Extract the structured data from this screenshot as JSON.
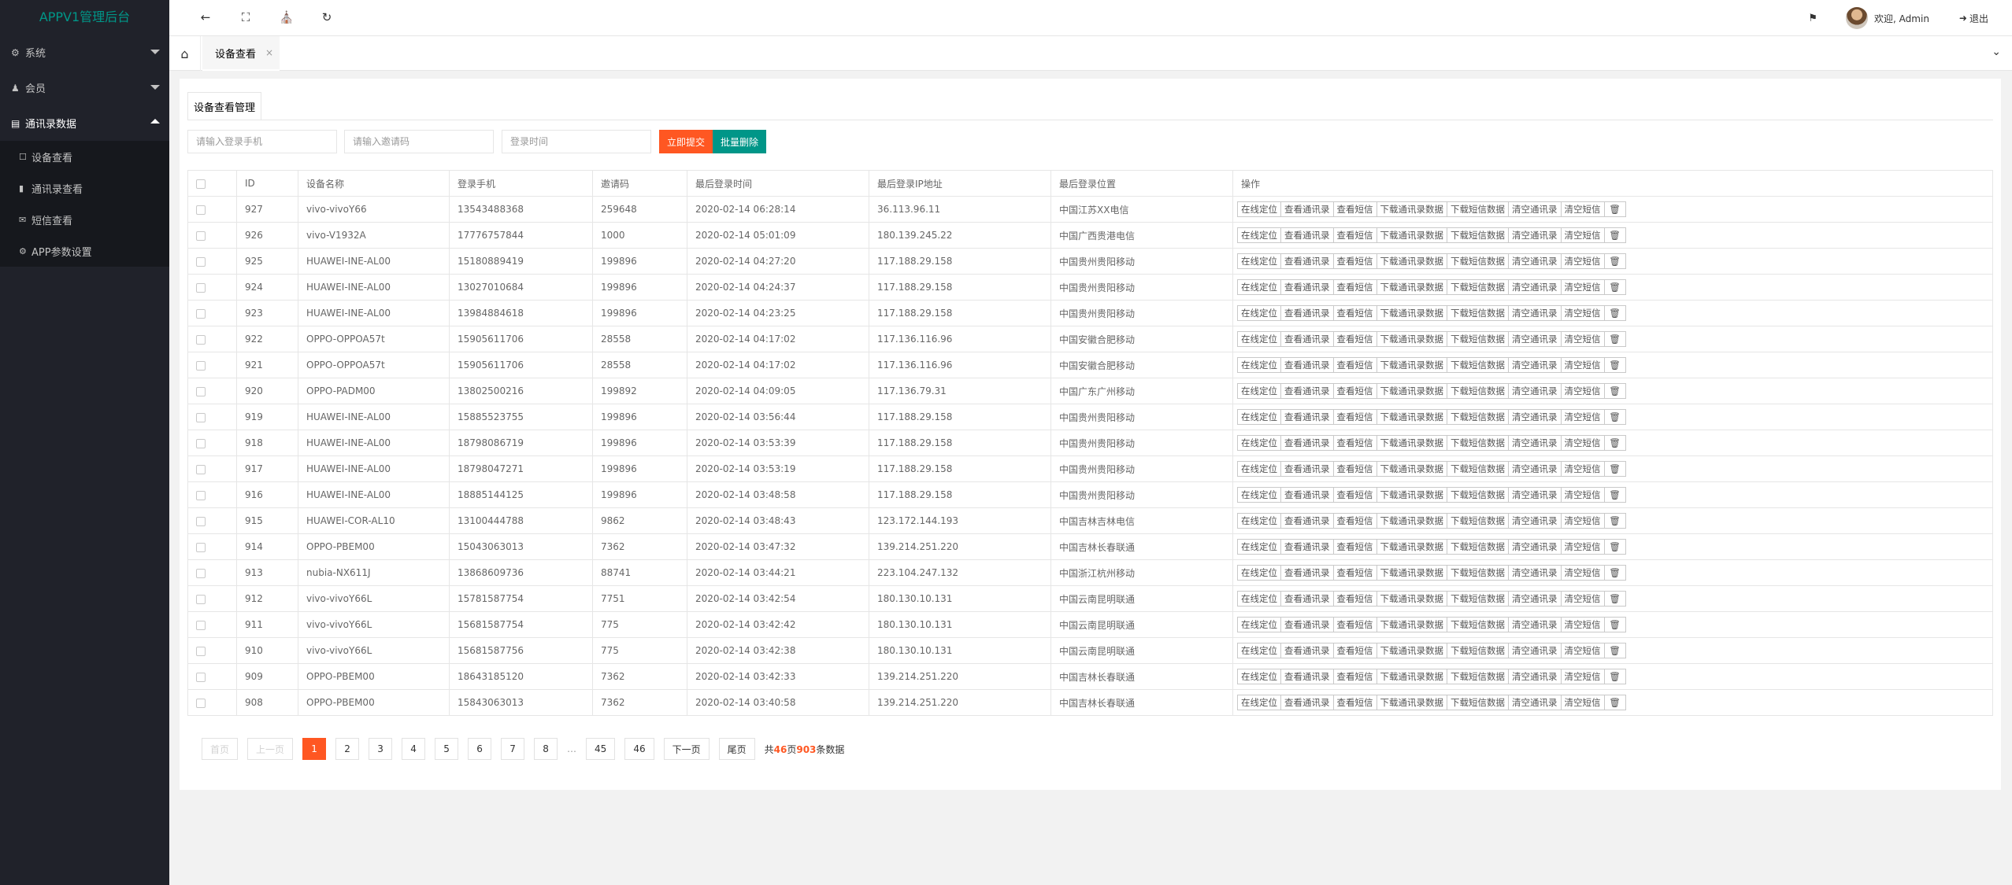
{
  "app": {
    "title": "APPV1管理后台"
  },
  "sidebar": {
    "menus": [
      {
        "label": "系统",
        "icon": "gear-icon",
        "glyph": "⚙"
      },
      {
        "label": "会员",
        "icon": "users-icon",
        "glyph": "👥"
      },
      {
        "label": "通讯录数据",
        "icon": "table-icon",
        "glyph": "▤"
      }
    ],
    "sub": [
      {
        "label": "设备查看",
        "icon": "lock-icon",
        "glyph": "🔒"
      },
      {
        "label": "通讯录查看",
        "icon": "book-icon",
        "glyph": "📕"
      },
      {
        "label": "短信查看",
        "icon": "envelope-icon",
        "glyph": "✉"
      },
      {
        "label": "APP参数设置",
        "icon": "gear-icon",
        "glyph": "⚙"
      }
    ]
  },
  "header": {
    "welcome": "欢迎, Admin",
    "logout": "退出"
  },
  "tabs": {
    "current": "设备查看",
    "close": "×"
  },
  "panel": {
    "title": "设备查看管理"
  },
  "search": {
    "phone_placeholder": "请输入登录手机",
    "invite_placeholder": "请输入邀请码",
    "time_placeholder": "登录时间",
    "submit": "立即提交",
    "batch_delete": "批量删除"
  },
  "table": {
    "headers": [
      "ID",
      "设备名称",
      "登录手机",
      "邀请码",
      "最后登录时间",
      "最后登录IP地址",
      "最后登录位置",
      "操作"
    ],
    "actions": [
      "在线定位",
      "查看通讯录",
      "查看短信",
      "下载通讯录数据",
      "下载短信数据",
      "清空通讯录",
      "清空短信"
    ],
    "rows": [
      [
        "927",
        "vivo-vivoY66",
        "13543488368",
        "259648",
        "2020-02-14 06:28:14",
        "36.113.96.11",
        "中国江苏XX电信"
      ],
      [
        "926",
        "vivo-V1932A",
        "17776757844",
        "1000",
        "2020-02-14 05:01:09",
        "180.139.245.22",
        "中国广西贵港电信"
      ],
      [
        "925",
        "HUAWEI-INE-AL00",
        "15180889419",
        "199896",
        "2020-02-14 04:27:20",
        "117.188.29.158",
        "中国贵州贵阳移动"
      ],
      [
        "924",
        "HUAWEI-INE-AL00",
        "13027010684",
        "199896",
        "2020-02-14 04:24:37",
        "117.188.29.158",
        "中国贵州贵阳移动"
      ],
      [
        "923",
        "HUAWEI-INE-AL00",
        "13984884618",
        "199896",
        "2020-02-14 04:23:25",
        "117.188.29.158",
        "中国贵州贵阳移动"
      ],
      [
        "922",
        "OPPO-OPPOA57t",
        "15905611706",
        "28558",
        "2020-02-14 04:17:02",
        "117.136.116.96",
        "中国安徽合肥移动"
      ],
      [
        "921",
        "OPPO-OPPOA57t",
        "15905611706",
        "28558",
        "2020-02-14 04:17:02",
        "117.136.116.96",
        "中国安徽合肥移动"
      ],
      [
        "920",
        "OPPO-PADM00",
        "13802500216",
        "199892",
        "2020-02-14 04:09:05",
        "117.136.79.31",
        "中国广东广州移动"
      ],
      [
        "919",
        "HUAWEI-INE-AL00",
        "15885523755",
        "199896",
        "2020-02-14 03:56:44",
        "117.188.29.158",
        "中国贵州贵阳移动"
      ],
      [
        "918",
        "HUAWEI-INE-AL00",
        "18798086719",
        "199896",
        "2020-02-14 03:53:39",
        "117.188.29.158",
        "中国贵州贵阳移动"
      ],
      [
        "917",
        "HUAWEI-INE-AL00",
        "18798047271",
        "199896",
        "2020-02-14 03:53:19",
        "117.188.29.158",
        "中国贵州贵阳移动"
      ],
      [
        "916",
        "HUAWEI-INE-AL00",
        "18885144125",
        "199896",
        "2020-02-14 03:48:58",
        "117.188.29.158",
        "中国贵州贵阳移动"
      ],
      [
        "915",
        "HUAWEI-COR-AL10",
        "13100444788",
        "9862",
        "2020-02-14 03:48:43",
        "123.172.144.193",
        "中国吉林吉林电信"
      ],
      [
        "914",
        "OPPO-PBEM00",
        "15043063013",
        "7362",
        "2020-02-14 03:47:32",
        "139.214.251.220",
        "中国吉林长春联通"
      ],
      [
        "913",
        "nubia-NX611J",
        "13868609736",
        "88741",
        "2020-02-14 03:44:21",
        "223.104.247.132",
        "中国浙江杭州移动"
      ],
      [
        "912",
        "vivo-vivoY66L",
        "15781587754",
        "7751",
        "2020-02-14 03:42:54",
        "180.130.10.131",
        "中国云南昆明联通"
      ],
      [
        "911",
        "vivo-vivoY66L",
        "15681587754",
        "775",
        "2020-02-14 03:42:42",
        "180.130.10.131",
        "中国云南昆明联通"
      ],
      [
        "910",
        "vivo-vivoY66L",
        "15681587756",
        "775",
        "2020-02-14 03:42:38",
        "180.130.10.131",
        "中国云南昆明联通"
      ],
      [
        "909",
        "OPPO-PBEM00",
        "18643185120",
        "7362",
        "2020-02-14 03:42:33",
        "139.214.251.220",
        "中国吉林长春联通"
      ],
      [
        "908",
        "OPPO-PBEM00",
        "15843063013",
        "7362",
        "2020-02-14 03:40:58",
        "139.214.251.220",
        "中国吉林长春联通"
      ]
    ]
  },
  "pager": {
    "first": "首页",
    "prev": "上一页",
    "pages": [
      "1",
      "2",
      "3",
      "4",
      "5",
      "6",
      "7",
      "8"
    ],
    "dots": "…",
    "tail": [
      "45",
      "46"
    ],
    "next": "下一页",
    "last": "尾页",
    "info_pre": "共",
    "total_pages": "46",
    "info_mid": "页",
    "total_items": "903",
    "info_post": "条数据"
  }
}
